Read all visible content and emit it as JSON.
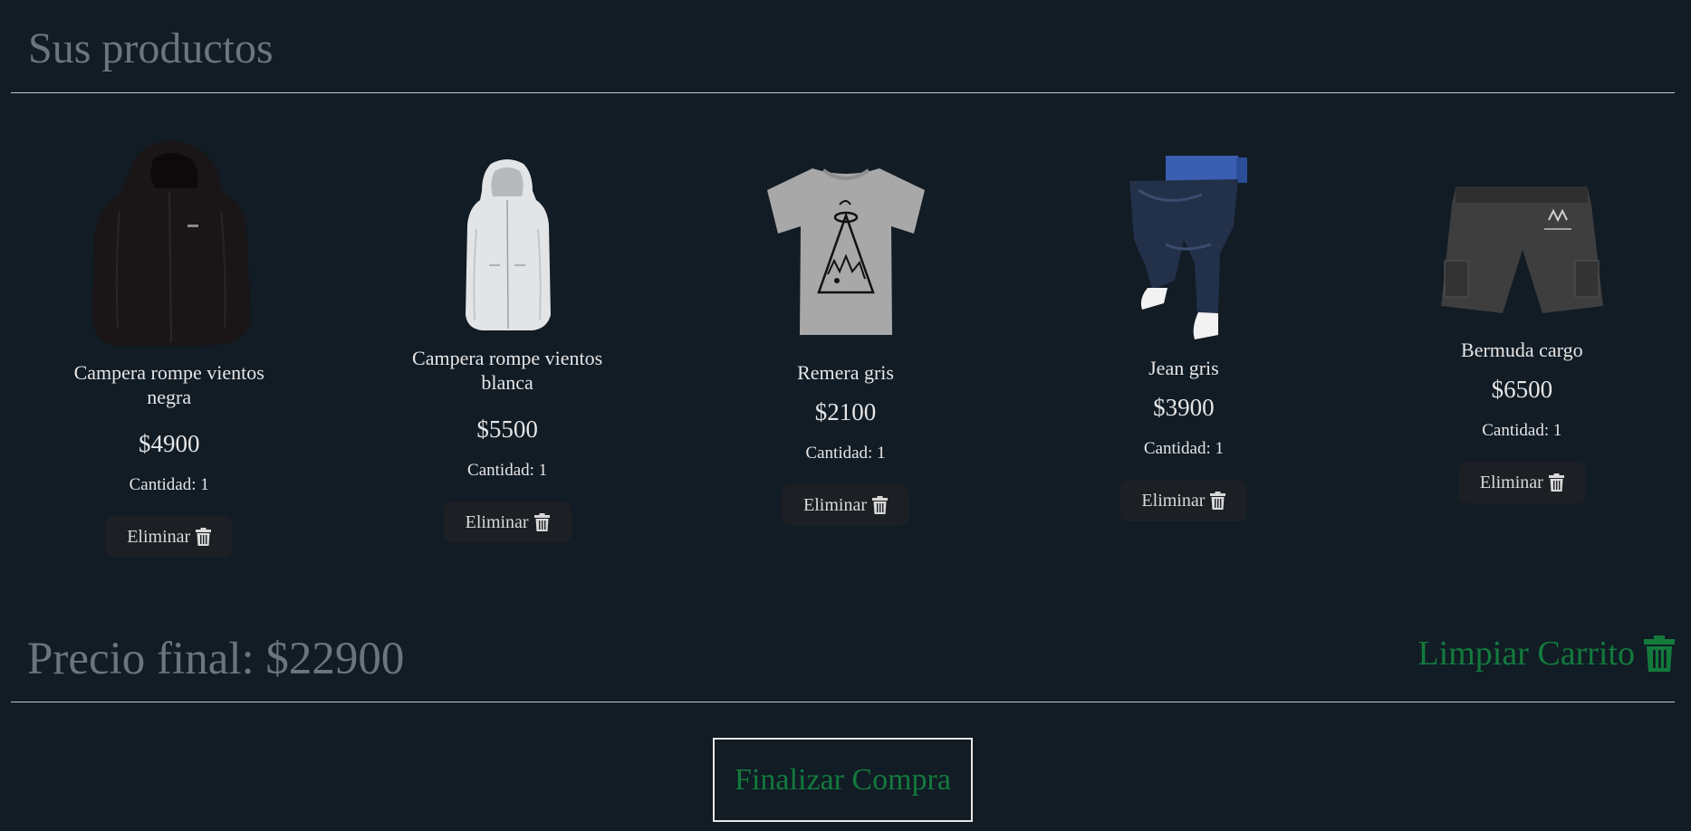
{
  "header": {
    "title": "Sus productos"
  },
  "products": [
    {
      "name": "Campera rompe vientos negra",
      "price": "$4900",
      "quantity": "Cantidad: 1",
      "delete_label": "Eliminar",
      "image": "black-windbreaker-jacket"
    },
    {
      "name": "Campera rompe vientos blanca",
      "price": "$5500",
      "quantity": "Cantidad: 1",
      "delete_label": "Eliminar",
      "image": "white-windbreaker-jacket"
    },
    {
      "name": "Remera gris",
      "price": "$2100",
      "quantity": "Cantidad: 1",
      "delete_label": "Eliminar",
      "image": "grey-tshirt"
    },
    {
      "name": "Jean gris",
      "price": "$3900",
      "quantity": "Cantidad: 1",
      "delete_label": "Eliminar",
      "image": "grey-jeans"
    },
    {
      "name": "Bermuda cargo",
      "price": "$6500",
      "quantity": "Cantidad: 1",
      "delete_label": "Eliminar",
      "image": "cargo-shorts"
    }
  ],
  "summary": {
    "final_price": "Precio final: $22900",
    "clear_cart_label": "Limpiar Carrito"
  },
  "checkout": {
    "label": "Finalizar Compra"
  },
  "colors": {
    "background": "#111c25",
    "muted_text": "#6c757d",
    "accent_green": "#137a3c",
    "button_bg": "#1c1f24"
  }
}
